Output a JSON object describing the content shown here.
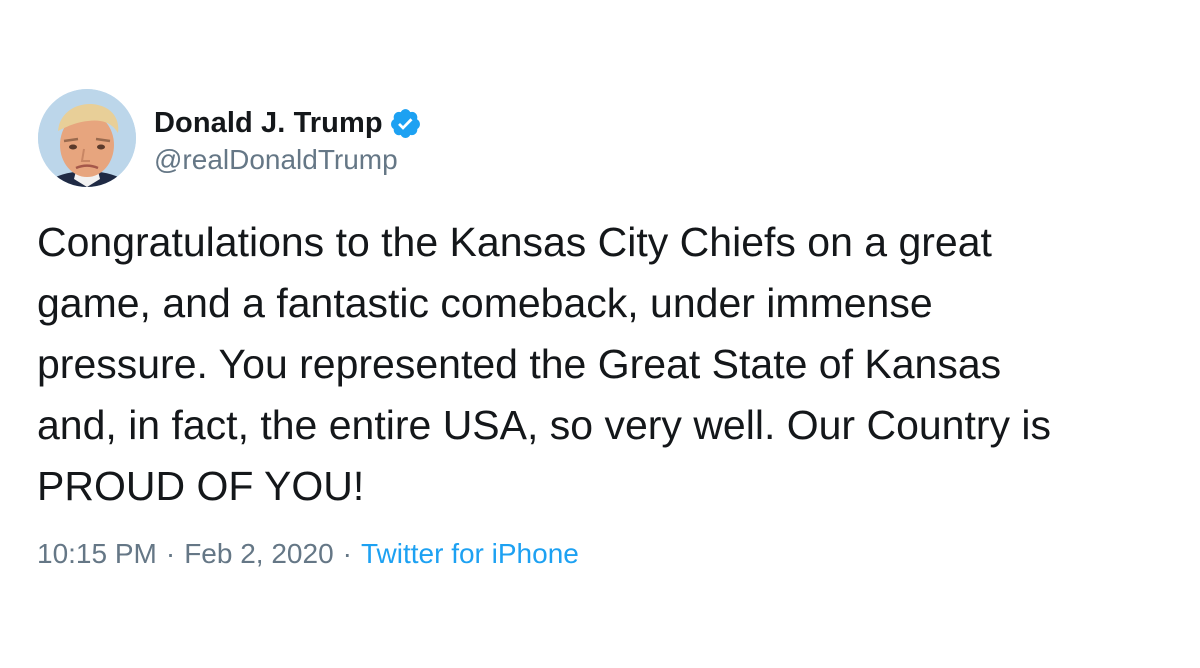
{
  "author": {
    "display_name": "Donald J. Trump",
    "handle": "@realDonaldTrump",
    "verified": true,
    "avatar_icon": "profile-photo",
    "verified_icon": "verified-badge-icon"
  },
  "tweet": {
    "text": "Congratulations to the Kansas City Chiefs on a great\ngame, and a fantastic comeback, under immense\npressure. You represented the Great State of Kansas\nand, in fact, the entire USA, so very well. Our Country is\nPROUD OF YOU!",
    "time": "10:15 PM",
    "date": "Feb 2, 2020",
    "separator": "·",
    "source": "Twitter for iPhone"
  },
  "colors": {
    "text": "#14171a",
    "secondary": "#657786",
    "link": "#1da1f2",
    "verified": "#1da1f2"
  }
}
